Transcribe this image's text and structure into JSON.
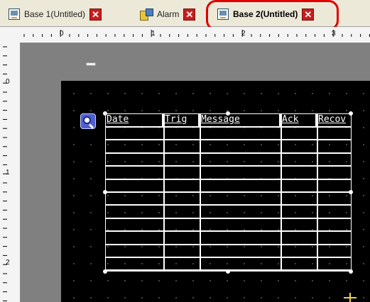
{
  "tabs": [
    {
      "label": "Base 1(Untitled)",
      "icon": "screen-icon",
      "active": false
    },
    {
      "label": "Alarm",
      "icon": "alarm-icon",
      "active": false
    },
    {
      "label": "Base 2(Untitled)",
      "icon": "screen-icon",
      "active": true
    }
  ],
  "close_glyph": "✕",
  "ruler": {
    "h_ticks": [
      "0",
      "1",
      "2",
      "3"
    ],
    "v_ticks": [
      "0",
      "1",
      "2"
    ]
  },
  "table": {
    "columns": [
      "Date",
      "Trig",
      "Message",
      "Ack",
      "Recov"
    ],
    "row_count": 11
  },
  "colors": {
    "highlight": "#e00000",
    "screen_bg": "#000000",
    "grid_lines": "#ffffff",
    "close_button": "#c81e1e"
  }
}
